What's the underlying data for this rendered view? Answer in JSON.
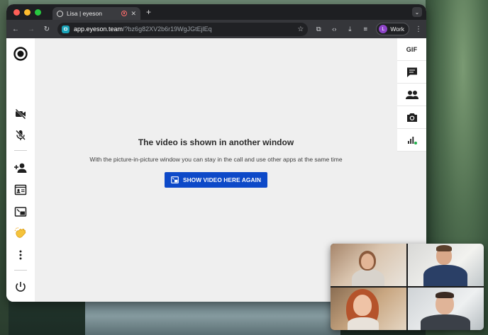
{
  "browser": {
    "tab": {
      "title": "Lisa | eyeson"
    },
    "url": {
      "host": "app.eyeson.team",
      "path": "/?bz6g82XV2b6r19WgJGtEjlEq"
    },
    "profile": {
      "initial": "L",
      "label": "Work"
    },
    "icons": {
      "back": "arrow-left-icon",
      "forward": "arrow-right-icon",
      "reload": "reload-icon",
      "bookmark": "star-icon",
      "extensions": "puzzle-icon",
      "devtools": "code-icon",
      "downloads": "download-icon",
      "media": "media-queue-icon",
      "menu": "kebab-icon"
    }
  },
  "left_sidebar": {
    "items": [
      {
        "name": "eyeson-logo-icon"
      },
      {
        "name": "camera-off-icon"
      },
      {
        "name": "mic-off-icon"
      },
      {
        "name": "add-participant-icon"
      },
      {
        "name": "presentation-icon"
      },
      {
        "name": "picture-in-picture-icon"
      },
      {
        "name": "reaction-clap-icon"
      },
      {
        "name": "more-options-icon"
      },
      {
        "name": "leave-call-icon"
      }
    ]
  },
  "right_sidebar": {
    "gif_label": "GIF",
    "items": [
      {
        "name": "gif-button"
      },
      {
        "name": "chat-icon"
      },
      {
        "name": "participants-icon"
      },
      {
        "name": "snapshot-camera-icon"
      },
      {
        "name": "connection-stats-icon"
      }
    ]
  },
  "main": {
    "title": "The video is shown in another window",
    "subtitle": "With the picture-in-picture window you can stay in the call and use other apps at the same time",
    "button_label": "SHOW VIDEO HERE AGAIN"
  },
  "colors": {
    "primary": "#0d49c8",
    "tab_bar": "#1e1f22",
    "toolbar": "#35363a",
    "page_bg": "#efefef"
  }
}
